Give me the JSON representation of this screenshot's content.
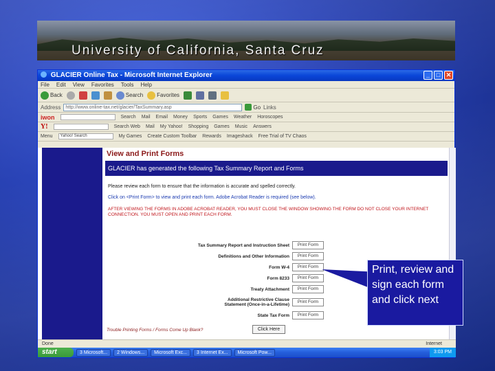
{
  "slide": {
    "banner_title": "University of California, Santa Cruz",
    "callout_text": "Print, review and sign each form and click next"
  },
  "window": {
    "title": "GLACIER Online Tax - Microsoft Internet Explorer",
    "menu": [
      "File",
      "Edit",
      "View",
      "Favorites",
      "Tools",
      "Help"
    ],
    "toolbar": {
      "back_label": "Back",
      "search_label": "Search",
      "favorites_label": "Favorites"
    },
    "address": {
      "label": "Address",
      "value": "http://www.online-tax.net/glacier/TaxSummary.asp",
      "go_label": "Go",
      "links_label": "Links"
    },
    "linkbar1": {
      "logo": "iwon",
      "search_label": "Search",
      "items": [
        "Mail",
        "Email",
        "Money",
        "Sports",
        "Games",
        "Weather",
        "Horoscopes"
      ]
    },
    "linkbar2": {
      "logo": "Y!",
      "search_label": "Search Web",
      "items": [
        "Mail",
        "My Yahoo!",
        "Shopping",
        "Games",
        "Music",
        "Answers"
      ]
    },
    "linkbar3": {
      "menu_label": "Menu",
      "search_field": "Yahoo! Search",
      "items": [
        "My Games",
        "Create Custom Toolbar",
        "Rewards",
        "Imageshack",
        "Free Trial of TV Chaos"
      ]
    }
  },
  "page": {
    "title": "View and Print Forms",
    "notice": "GLACIER has generated the following Tax Summary Report and Forms",
    "instruction": "Please review each form to ensure that the information is accurate and spelled correctly.",
    "instruction2": "Click on <Print Form> to view and print each form. Adobe Acrobat Reader is required (see below).",
    "warning": "AFTER VIEWING THE FORMS IN ADOBE ACROBAT READER, YOU MUST CLOSE THE WINDOW SHOWING THE FORM DO NOT CLOSE YOUR INTERNET CONNECTION. YOU MUST OPEN AND PRINT EACH FORM.",
    "forms": [
      {
        "label": "Tax Summary Report and Instruction Sheet",
        "button": "Print Form"
      },
      {
        "label": "Definitions and Other Information",
        "button": "Print Form"
      },
      {
        "label": "Form W-4",
        "button": "Print Form"
      },
      {
        "label": "Form 8233",
        "button": "Print Form"
      },
      {
        "label": "Treaty Attachment",
        "button": "Print Form"
      },
      {
        "label": "Additional Restrictive Clause Statement (Once-in-a-Lifetime)",
        "button": "Print Form"
      },
      {
        "label": "State Tax Form",
        "button": "Print Form"
      }
    ],
    "trouble_link": "Trouble Printing Forms / Forms Come Up Blank?",
    "next_button": "Click Here"
  },
  "statusbar": {
    "status": "Done",
    "zone": "Internet"
  },
  "taskbar": {
    "start_label": "start",
    "items": [
      "3 Microsoft...",
      "2 Windows...",
      "Microsoft Exc...",
      "3 Internet Ex...",
      "Microsoft Pow..."
    ],
    "clock": "3:03 PM"
  },
  "colors": {
    "slide_background": "#2a44b8",
    "nav_panel": "#1a1a8c",
    "page_title": "#8b1a1a",
    "warning_text": "#c0141a",
    "callout_bg": "#1a1aa0"
  }
}
